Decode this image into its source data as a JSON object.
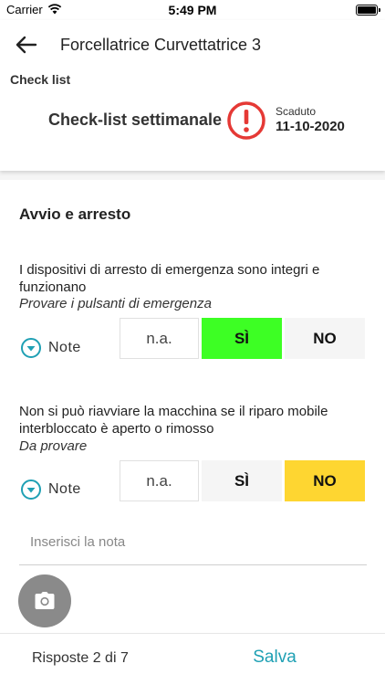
{
  "status_bar": {
    "carrier": "Carrier",
    "time": "5:49 PM"
  },
  "header": {
    "title": "Forcellatrice Curvettatrice 3",
    "section_label": "Check list",
    "checklist_name": "Check-list settimanale",
    "due_label": "Scaduto",
    "due_date": "11-10-2020",
    "icons": {
      "back": "arrow-back-icon",
      "alert": "alert-circle-icon"
    }
  },
  "group": {
    "title": "Avvio e arresto"
  },
  "questions": [
    {
      "text": "I dispositivi di arresto di emergenza sono integri e funzionano",
      "hint": "Provare i pulsanti di emergenza",
      "note_label": "Note",
      "options": {
        "na": "n.a.",
        "si": "SÌ",
        "no": "NO"
      },
      "selected": "si"
    },
    {
      "text": "Non si può riavviare la macchina se il riparo mobile interbloccato è aperto o rimosso",
      "hint": "Da provare",
      "note_label": "Note",
      "options": {
        "na": "n.a.",
        "si": "SÌ",
        "no": "NO"
      },
      "selected": "no",
      "note_placeholder": "Inserisci la nota"
    }
  ],
  "footer": {
    "answers": "Risposte 2 di 7",
    "save_label": "Salva"
  },
  "colors": {
    "accent": "#1fa0b4",
    "alert": "#e53935",
    "selected_yes": "#3dff24",
    "selected_no": "#fed631",
    "camera_button": "#8a8a8a"
  }
}
